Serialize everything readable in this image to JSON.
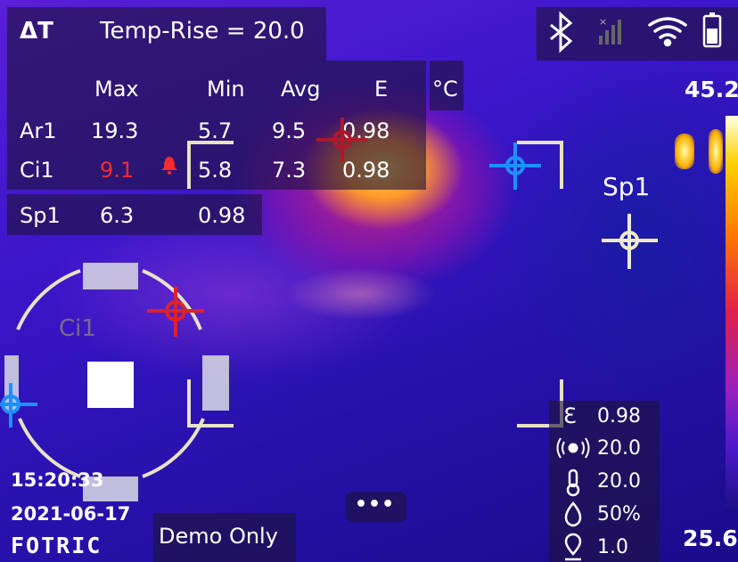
{
  "top_bar": {
    "delta_symbol": "ΔT",
    "mode_label": "Temp-Rise = 20.0"
  },
  "status_icons": [
    "bluetooth-icon",
    "cellular-signal-icon",
    "wifi-icon",
    "battery-icon"
  ],
  "measurement_table": {
    "columns": [
      "Max",
      "Min",
      "Avg",
      "E"
    ],
    "unit": "°C",
    "rows": [
      {
        "name": "Ar1",
        "max": "19.3",
        "min": "5.7",
        "avg": "9.5",
        "e": "0.98"
      },
      {
        "name": "Ci1",
        "max": "9.1",
        "min": "5.8",
        "avg": "7.3",
        "e": "0.98",
        "max_alarm": true
      }
    ],
    "spot_row": {
      "name": "Sp1",
      "value": "6.3",
      "e": "0.98"
    }
  },
  "colors": {
    "alarm": "#ff2a2a",
    "accent_blue": "#1e90ff",
    "marker_red": "#e0202a"
  },
  "scale": {
    "max": "45.2",
    "min": "25.6"
  },
  "image_labels": {
    "sp1": "Sp1",
    "ci1": "Ci1"
  },
  "parameters": [
    {
      "icon": "emissivity-icon",
      "value": "0.98"
    },
    {
      "icon": "reflected-temp-icon",
      "value": "20.0"
    },
    {
      "icon": "thermometer-icon",
      "value": "20.0"
    },
    {
      "icon": "humidity-icon",
      "value": "50%"
    },
    {
      "icon": "distance-icon",
      "value": "1.0"
    }
  ],
  "timestamp": {
    "time": "15:20:33",
    "date": "2021-06-17"
  },
  "brand": "FOTRIC",
  "watermark": "Demo Only",
  "more_button": "•••"
}
